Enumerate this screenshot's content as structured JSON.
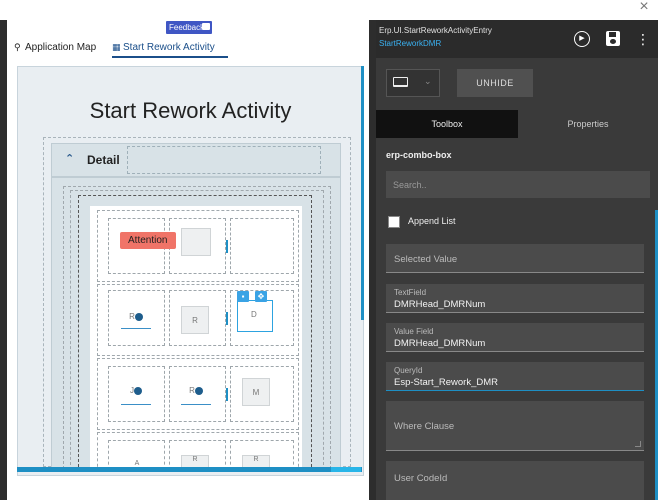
{
  "topbar": {
    "close_glyph": "×"
  },
  "feedback": {
    "label": "Feedback"
  },
  "tabs": [
    {
      "label": "Application Map",
      "icon": "sitemap-icon"
    },
    {
      "label": "Start Rework Activity",
      "icon": "table-icon"
    }
  ],
  "canvas": {
    "page_title": "Start Rework Activity",
    "detail_label": "Detail",
    "attention_label": "Attention",
    "controls": {
      "r1c2": "",
      "r2c1": "R",
      "r2c2": "R",
      "r2c3": "D",
      "r3c1": "J",
      "r3c2": "R",
      "r3c3": "M",
      "r4c1": "A",
      "r4c2": "R",
      "r4c3": "R"
    }
  },
  "right_panel": {
    "title": "Erp.UI.StartReworkActivityEntry",
    "subtitle": "StartReworkDMR",
    "unhide_label": "UNHIDE",
    "segment_toolbox": "Toolbox",
    "segment_properties": "Properties",
    "component_name": "erp-combo-box",
    "search_placeholder": "Search..",
    "append_list_label": "Append List",
    "fields": {
      "selected_value": {
        "label": "Selected Value",
        "value": ""
      },
      "text_field": {
        "label": "TextField",
        "value": "DMRHead_DMRNum"
      },
      "value_field": {
        "label": "Value Field",
        "value": "DMRHead_DMRNum"
      },
      "query_id": {
        "label": "QueryId",
        "value": "Esp-Start_Rework_DMR"
      },
      "where_clause": {
        "label": "Where Clause",
        "value": ""
      },
      "user_code_id": {
        "label": "User CodeId",
        "value": ""
      }
    }
  },
  "colors": {
    "accent_blue": "#1e8fc4",
    "feedback_blue": "#3f56c4",
    "attention_red": "#f07468",
    "dark_panel": "#3a3a3a"
  }
}
